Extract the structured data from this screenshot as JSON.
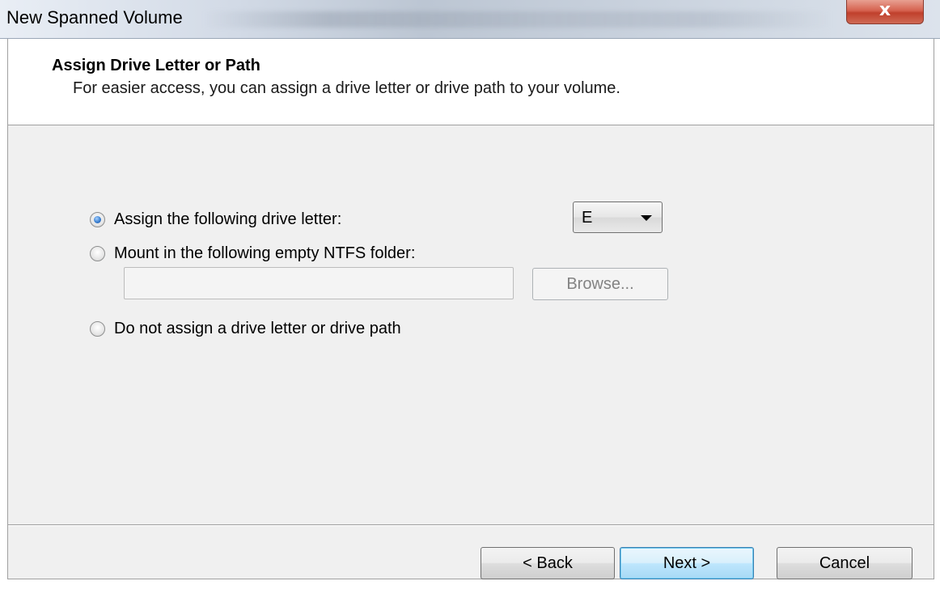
{
  "window": {
    "title": "New Spanned Volume",
    "close_label": "x"
  },
  "header": {
    "title": "Assign Drive Letter or Path",
    "subtitle": "For easier access, you can assign a drive letter or drive path to your volume."
  },
  "options": {
    "assign_letter": {
      "label": "Assign the following drive letter:",
      "checked": true
    },
    "mount_folder": {
      "label": "Mount in the following empty NTFS folder:",
      "checked": false
    },
    "no_assign": {
      "label": "Do not assign a drive letter or drive path",
      "checked": false
    }
  },
  "drive_letter": {
    "selected": "E"
  },
  "folder_path": {
    "value": ""
  },
  "buttons": {
    "browse": "Browse...",
    "back": "< Back",
    "next": "Next >",
    "cancel": "Cancel"
  },
  "colors": {
    "dialog_bg": "#f0f0f0",
    "header_bg": "#ffffff",
    "close_red": "#c0402c",
    "default_button_border": "#3c7fb1"
  }
}
